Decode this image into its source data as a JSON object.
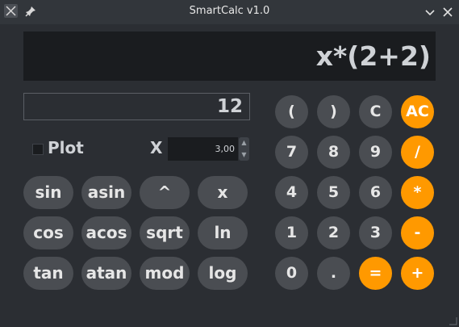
{
  "window": {
    "title": "SmartCalc v1.0"
  },
  "display": {
    "expression": "x*(2+2)"
  },
  "result": {
    "value": "12"
  },
  "plot": {
    "label": "Plot",
    "checked": false
  },
  "x_field": {
    "label": "X",
    "value": "3,00"
  },
  "function_buttons": {
    "sin": "sin",
    "asin": "asin",
    "pow": "^",
    "x": "x",
    "cos": "cos",
    "acos": "acos",
    "sqrt": "sqrt",
    "ln": "ln",
    "tan": "tan",
    "atan": "atan",
    "mod": "mod",
    "log": "log"
  },
  "keypad": {
    "lparen": "(",
    "rparen": ")",
    "clear": "C",
    "all_clear": "AC",
    "n7": "7",
    "n8": "8",
    "n9": "9",
    "div": "/",
    "n4": "4",
    "n5": "5",
    "n6": "6",
    "mul": "*",
    "n1": "1",
    "n2": "2",
    "n3": "3",
    "minus": "-",
    "n0": "0",
    "dot": ".",
    "equals": "=",
    "plus": "+"
  },
  "colors": {
    "accent": "#ff9900",
    "button": "#4a4d52",
    "background": "#2b2e33"
  }
}
